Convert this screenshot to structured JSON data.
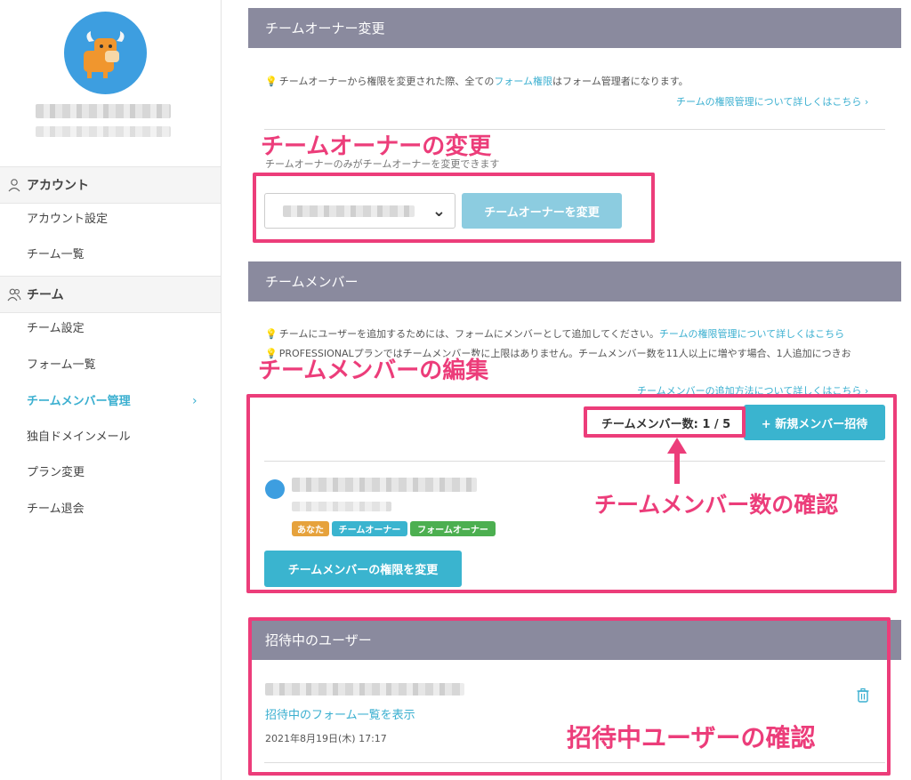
{
  "sidebar": {
    "groups": [
      {
        "label": "アカウント",
        "icon": "user-icon"
      },
      {
        "label": "チーム",
        "icon": "team-icon"
      }
    ],
    "account_items": [
      "アカウント設定",
      "チーム一覧"
    ],
    "team_items": [
      "チーム設定",
      "フォーム一覧",
      "チームメンバー管理",
      "独自ドメインメール",
      "プラン変更",
      "チーム退会"
    ],
    "active_item": "チームメンバー管理",
    "chevron": "›"
  },
  "owner_section": {
    "header": "チームオーナー変更",
    "note_prefix": "チームオーナーから権限を変更された際、全ての",
    "note_link": "フォーム権限",
    "note_suffix": "はフォーム管理者になります。",
    "detail_link": "チームの権限管理について詳しくはこちら ›",
    "sub_note": "チームオーナーのみがチームオーナーを変更できます",
    "change_button": "チームオーナーを変更"
  },
  "member_section": {
    "header": "チームメンバー",
    "note1_prefix": "チームにユーザーを追加するためには、フォームにメンバーとして追加してください。",
    "note1_link": "チームの権限管理について詳しくはこちら",
    "note2": "PROFESSIONALプランではチームメンバー数に上限はありません。チームメンバー数を11人以上に増やす場合、1人追加につきお",
    "add_link": "チームメンバーの追加方法について詳しくはこちら ›",
    "member_count": "チームメンバー数: 1 / 5",
    "invite_button": "+ 新規メンバー招待",
    "tags": [
      "あなた",
      "チームオーナー",
      "フォームオーナー"
    ],
    "permission_button": "チームメンバーの権限を変更"
  },
  "invite_section": {
    "header": "招待中のユーザー",
    "form_list_link": "招待中のフォーム一覧を表示",
    "date": "2021年8月19日(木) 17:17"
  },
  "annotations": {
    "owner_change": "チームオーナーの変更",
    "member_edit": "チームメンバーの編集",
    "member_count_check": "チームメンバー数の確認",
    "invite_check": "招待中ユーザーの確認"
  },
  "colors": {
    "accent": "#3ab4cf",
    "header_bg": "#8a8a9e",
    "annotation": "#ec3d7a"
  }
}
